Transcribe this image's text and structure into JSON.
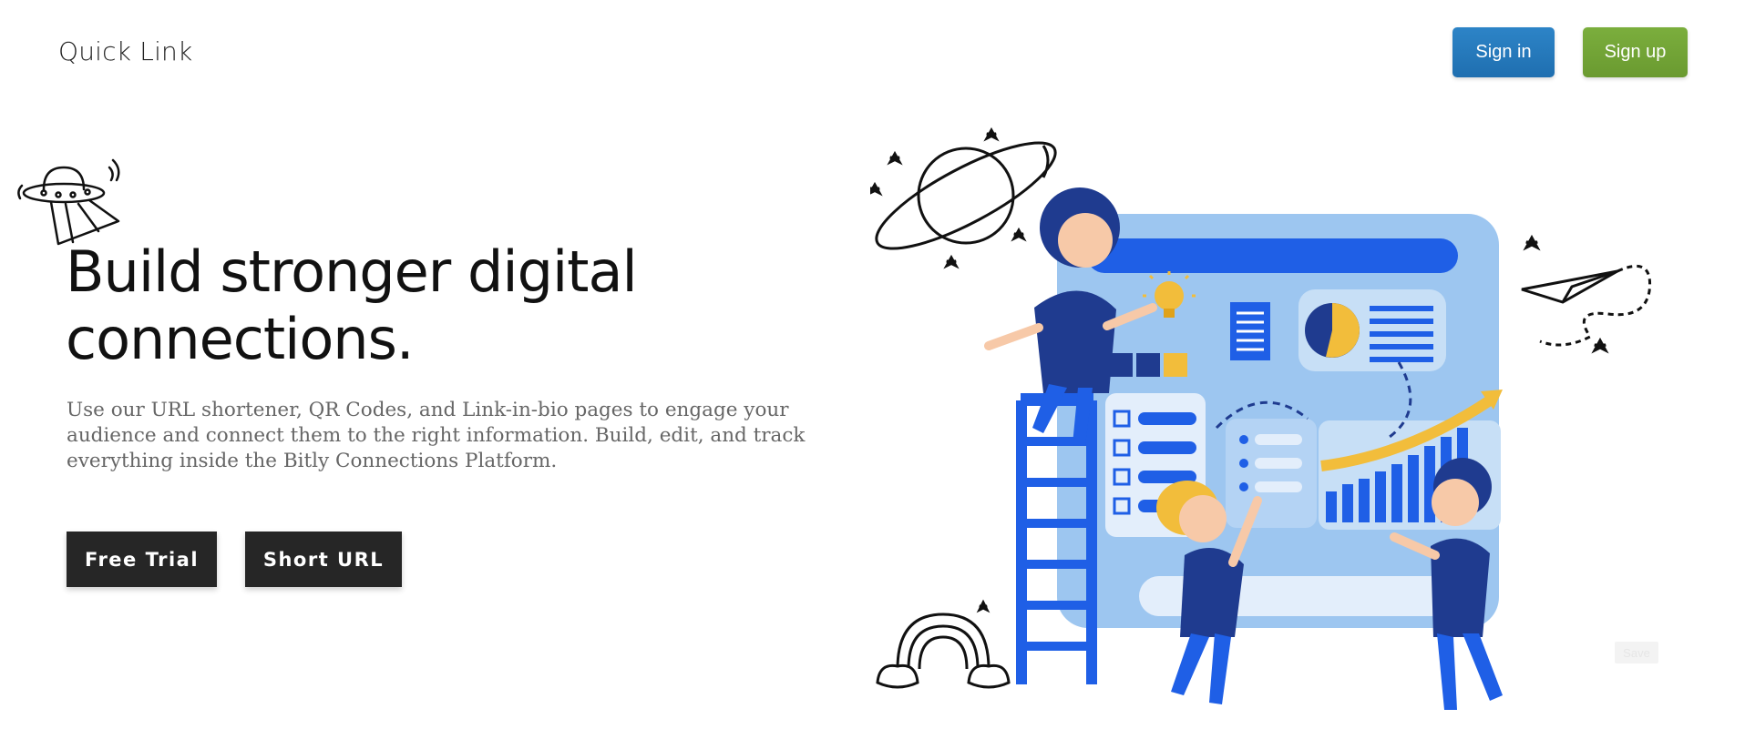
{
  "header": {
    "logo": "Quick Link",
    "signin_label": "Sign in",
    "signup_label": "Sign up"
  },
  "hero": {
    "title_line1": "Build stronger digital",
    "title_line2": "connections.",
    "description": "Use our URL shortener, QR Codes, and Link-in-bio pages to engage your audience and connect them to the right information. Build, edit, and track everything inside the Bitly Connections Platform.",
    "free_trial_label": "Free Trial",
    "short_url_label": "Short URL"
  },
  "illustration": {
    "icons": [
      "ufo-icon",
      "planet-icon",
      "paper-plane-icon",
      "rainbow-icon",
      "lightbulb-icon"
    ]
  },
  "save_label": "Save",
  "colors": {
    "signin": "#2378bd",
    "signup": "#73a535",
    "cta": "#262626",
    "illustration_blue": "#1f5fe6",
    "board_light": "#9dc6f0",
    "accent_yellow": "#f2bd3b"
  }
}
